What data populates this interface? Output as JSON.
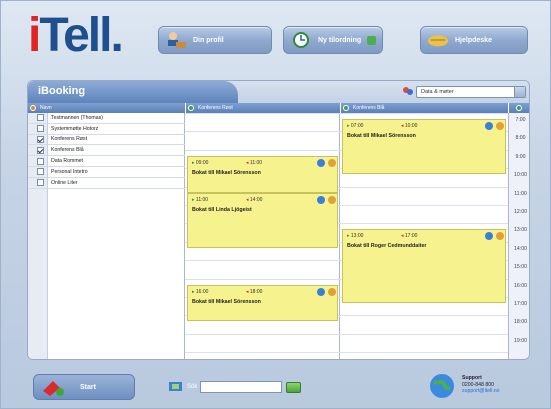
{
  "app": {
    "logo_i": "i",
    "logo_rest": "Tell."
  },
  "header": {
    "buttons": [
      {
        "label": "Din profil",
        "icon": "person-desk-icon"
      },
      {
        "label": "Ny tilordning",
        "icon": "clock-plus-icon"
      },
      {
        "label": "Hjelpdeske",
        "icon": "handshake-icon"
      }
    ]
  },
  "booking": {
    "title": "iBooking",
    "filter_value": "Data & møter",
    "col_people": "Navn",
    "col_room1": "Konferens Røst",
    "col_room2": "Konferens Blå"
  },
  "people": [
    {
      "name": "Testmannen (Thomas)",
      "checked": false
    },
    {
      "name": "Systemmøtte Hotorz",
      "checked": false
    },
    {
      "name": "Konferens Røst",
      "checked": true
    },
    {
      "name": "Konferens Blå",
      "checked": true
    },
    {
      "name": "Data Rommet",
      "checked": false
    },
    {
      "name": "Personal Intetro",
      "checked": false
    },
    {
      "name": "Online Liter",
      "checked": false
    }
  ],
  "events_col1": [
    {
      "start": "09:00",
      "end": "11:00",
      "title": "Bokat till Mikael Sörensson"
    },
    {
      "start": "11:00",
      "end": "14:00",
      "title": "Bokat till Linda Ljögeist"
    },
    {
      "start": "16:00",
      "end": "18:00",
      "title": "Bokat till Mikael Sörensson"
    }
  ],
  "events_col2": [
    {
      "start": "07:00",
      "end": "10:00",
      "title": "Bokat till Mikael Sörensson"
    },
    {
      "start": "13:00",
      "end": "17:00",
      "title": "Bokat till Roger Cedmunddaiter"
    }
  ],
  "hours": [
    "7:00",
    "8:00",
    "9:00",
    "10:00",
    "11:00",
    "12:00",
    "13:00",
    "14:00",
    "15:00",
    "16:00",
    "17:00",
    "18:00",
    "19:00"
  ],
  "footer": {
    "start_label": "Start",
    "search_label": "Sök",
    "support_title": "Support",
    "support_phone": "0200-848 800",
    "support_email": "support@itell.no"
  },
  "colors": {
    "accent": "#5e84bc",
    "event": "#f6f38f",
    "logo_red": "#e02424",
    "logo_blue": "#1f4f8e"
  }
}
